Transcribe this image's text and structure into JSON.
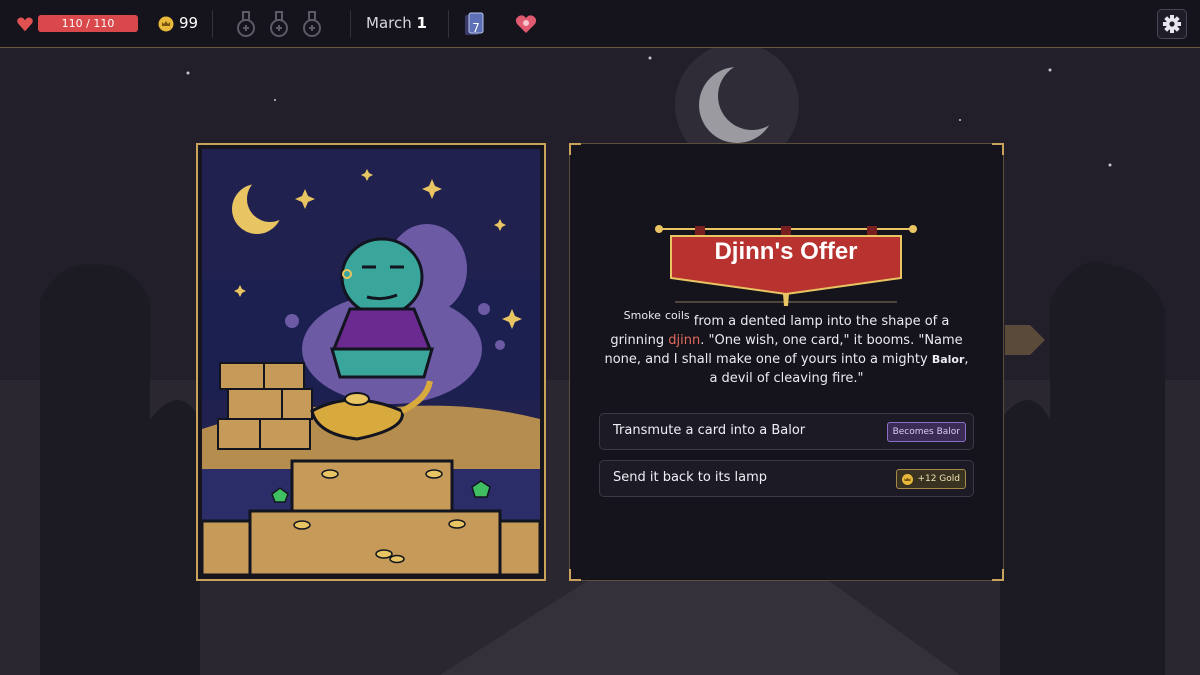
{
  "hud": {
    "health_text": "110 / 110",
    "health_fraction": 1.0,
    "gold": "99",
    "potion_slots": [
      "empty-potion-slot",
      "empty-potion-slot",
      "empty-potion-slot"
    ],
    "date_month": "March",
    "date_day": "1",
    "deck_count": "7",
    "icons": {
      "health": "heart-icon",
      "gold": "crown-coin-icon",
      "deck": "card-deck-icon",
      "relic": "heart-relic-icon",
      "settings": "gear-icon"
    }
  },
  "event": {
    "title": "Djinn's Offer",
    "story": {
      "word1": "Smoke",
      "word2": "coils",
      "part1": " from a dented lamp into the shape of a grinning ",
      "highlight": "djinn",
      "part2": ". \"One wish, one card,\" it booms. \"Name none, and I shall make one of yours into a mighty ",
      "card_name": "Balor",
      "part3": ", a devil of cleaving fire.\""
    },
    "choices": [
      {
        "label": "Transmute a card into a Balor",
        "tag": "Becomes Balor"
      },
      {
        "label": "Send it back to its lamp",
        "tag": "+12 Gold"
      }
    ]
  },
  "colors": {
    "accent_gold": "#c9a35c",
    "banner_red": "#b8322f",
    "highlight_red": "#e36a5a",
    "health_red": "#d9484a",
    "panel_bg": "#15131b"
  }
}
